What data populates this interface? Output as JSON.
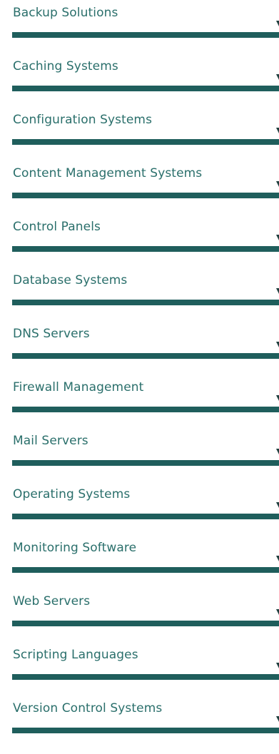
{
  "menu": {
    "items": [
      {
        "label": "Backup Solutions"
      },
      {
        "label": "Caching Systems"
      },
      {
        "label": "Configuration Systems"
      },
      {
        "label": "Content Management Systems"
      },
      {
        "label": "Control Panels"
      },
      {
        "label": "Database Systems"
      },
      {
        "label": "DNS Servers"
      },
      {
        "label": "Firewall Management"
      },
      {
        "label": "Mail Servers"
      },
      {
        "label": "Operating Systems"
      },
      {
        "label": "Monitoring Software"
      },
      {
        "label": "Web Servers"
      },
      {
        "label": "Scripting Languages"
      },
      {
        "label": "Version Control Systems"
      }
    ]
  },
  "colors": {
    "label": "#2a6f6b",
    "bar": "#1f5e5c",
    "chevron": "#1f3f3e"
  }
}
